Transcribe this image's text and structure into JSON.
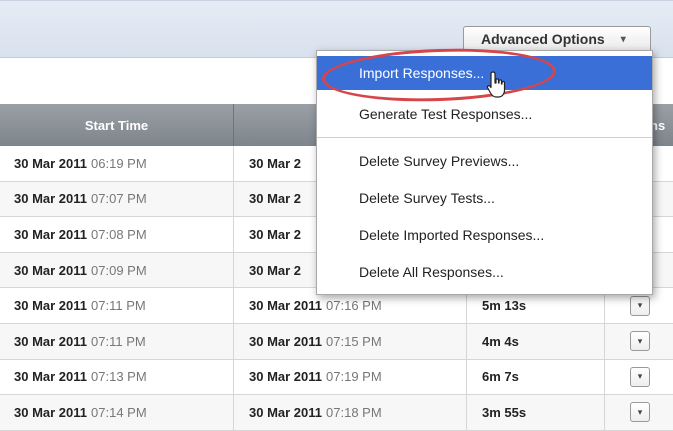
{
  "toolbar": {
    "advanced_options_label": "Advanced Options",
    "advanced_options_arrow": "▾"
  },
  "table": {
    "headers": {
      "start_time": "Start Time",
      "end_time": "",
      "last": "ns"
    },
    "rows": [
      {
        "start_date": "30 Mar 2011",
        "start_time": "06:19 PM",
        "end_date": "30 Mar 2",
        "end_time": "",
        "duration": "",
        "action": ""
      },
      {
        "start_date": "30 Mar 2011",
        "start_time": "07:07 PM",
        "end_date": "30 Mar 2",
        "end_time": "",
        "duration": "",
        "action": ""
      },
      {
        "start_date": "30 Mar 2011",
        "start_time": "07:08 PM",
        "end_date": "30 Mar 2",
        "end_time": "",
        "duration": "",
        "action": ""
      },
      {
        "start_date": "30 Mar 2011",
        "start_time": "07:09 PM",
        "end_date": "30 Mar 2",
        "end_time": "",
        "duration": "",
        "action": ""
      },
      {
        "start_date": "30 Mar 2011",
        "start_time": "07:11 PM",
        "end_date": "30 Mar 2011",
        "end_time": "07:16 PM",
        "duration": "5m 13s",
        "action": "▾"
      },
      {
        "start_date": "30 Mar 2011",
        "start_time": "07:11 PM",
        "end_date": "30 Mar 2011",
        "end_time": "07:15 PM",
        "duration": "4m 4s",
        "action": "▾"
      },
      {
        "start_date": "30 Mar 2011",
        "start_time": "07:13 PM",
        "end_date": "30 Mar 2011",
        "end_time": "07:19 PM",
        "duration": "6m 7s",
        "action": "▾"
      },
      {
        "start_date": "30 Mar 2011",
        "start_time": "07:14 PM",
        "end_date": "30 Mar 2011",
        "end_time": "07:18 PM",
        "duration": "3m 55s",
        "action": "▾"
      }
    ]
  },
  "menu": {
    "items": [
      {
        "label": "Import Responses...",
        "selected": true
      },
      {
        "label": "Generate Test Responses...",
        "selected": false
      },
      {
        "label": "Delete Survey Previews...",
        "selected": false
      },
      {
        "label": "Delete Survey Tests...",
        "selected": false
      },
      {
        "label": "Delete Imported Responses...",
        "selected": false
      },
      {
        "label": "Delete All Responses...",
        "selected": false
      }
    ]
  },
  "colors": {
    "menu_highlight": "#3a6fd8",
    "annotation_oval": "#d6454a",
    "header_bg": "#8a9096"
  },
  "icons": {
    "cursor": "hand-pointer-icon",
    "row_action": "chevron-down-icon"
  }
}
